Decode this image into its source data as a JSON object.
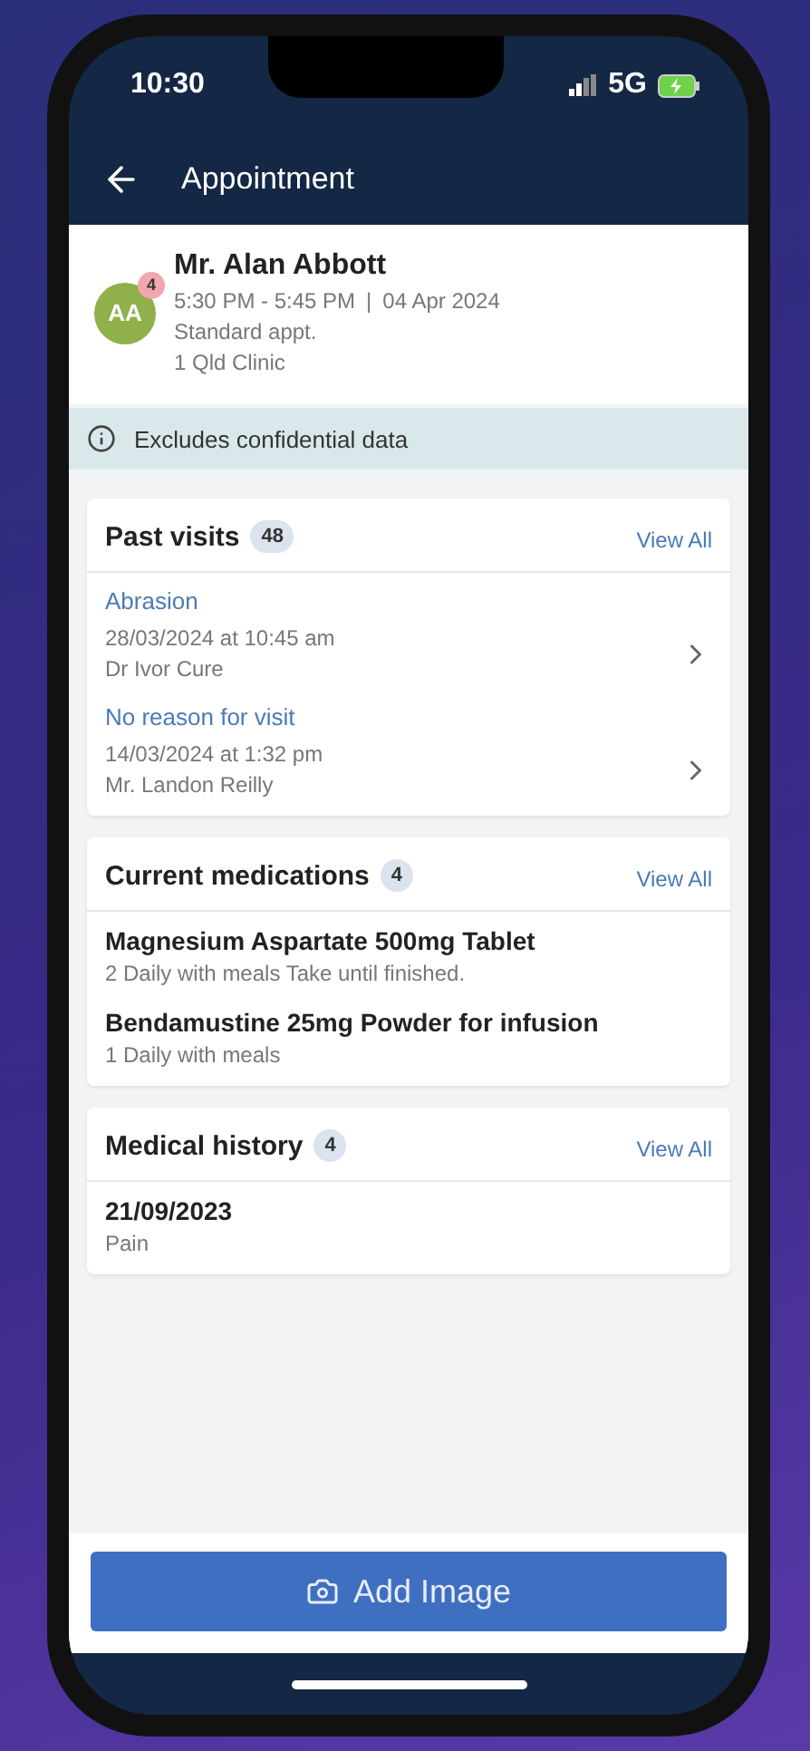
{
  "status_bar": {
    "time": "10:30",
    "network": "5G"
  },
  "header": {
    "title": "Appointment"
  },
  "patient": {
    "initials": "AA",
    "badge": "4",
    "name": "Mr. Alan Abbott",
    "time": "5:30 PM - 5:45 PM",
    "separator": "|",
    "date": "04 Apr 2024",
    "type": "Standard appt.",
    "clinic": "1 Qld Clinic"
  },
  "notice": {
    "text": "Excludes confidential data"
  },
  "past_visits": {
    "title": "Past visits",
    "count": "48",
    "link": "View All",
    "items": [
      {
        "reason": "Abrasion",
        "when": "28/03/2024 at 10:45 am",
        "clinician": "Dr Ivor Cure"
      },
      {
        "reason": "No reason for visit",
        "when": "14/03/2024 at 1:32 pm",
        "clinician": "Mr. Landon Reilly"
      }
    ]
  },
  "medications": {
    "title": "Current medications",
    "count": "4",
    "link": "View All",
    "items": [
      {
        "name": "Magnesium Aspartate 500mg Tablet",
        "dose": "2 Daily with meals Take until finished."
      },
      {
        "name": "Bendamustine 25mg Powder for infusion",
        "dose": "1 Daily with meals"
      }
    ]
  },
  "history": {
    "title": "Medical history",
    "count": "4",
    "link": "View All",
    "items": [
      {
        "date": "21/09/2023",
        "condition": "Pain"
      }
    ]
  },
  "action": {
    "label": "Add Image"
  }
}
